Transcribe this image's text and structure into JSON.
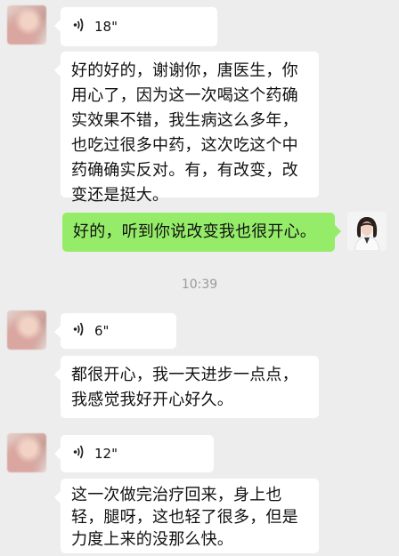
{
  "messages": [
    {
      "type": "voice",
      "side": "left",
      "duration": "18\""
    },
    {
      "type": "text",
      "side": "left",
      "text": "好的好的，谢谢你，唐医生，你用心了，因为这一次喝这个药确实效果不错，我生病这么多年，也吃过很多中药，这次吃这个中药确确实反对。有，有改变，改变还是挺大。"
    },
    {
      "type": "text",
      "side": "right",
      "text": "好的，听到你说改变我也很开心。"
    },
    {
      "type": "time",
      "text": "10:39"
    },
    {
      "type": "voice",
      "side": "left",
      "duration": "6\""
    },
    {
      "type": "text",
      "side": "left",
      "text": "都很开心，我一天进步一点点，我感觉我好开心好久。"
    },
    {
      "type": "voice",
      "side": "left",
      "duration": "12\""
    },
    {
      "type": "text",
      "side": "left",
      "text": "这一次做完治疗回来，身上也轻，腿呀，这也轻了很多，但是力度上来的没那么快。"
    }
  ],
  "colors": {
    "background": "#ededed",
    "bubble_self": "#95ec69",
    "bubble_other": "#ffffff",
    "timestamp": "#9a9a9a"
  },
  "icons": {
    "voice": "voice-wave-icon"
  }
}
